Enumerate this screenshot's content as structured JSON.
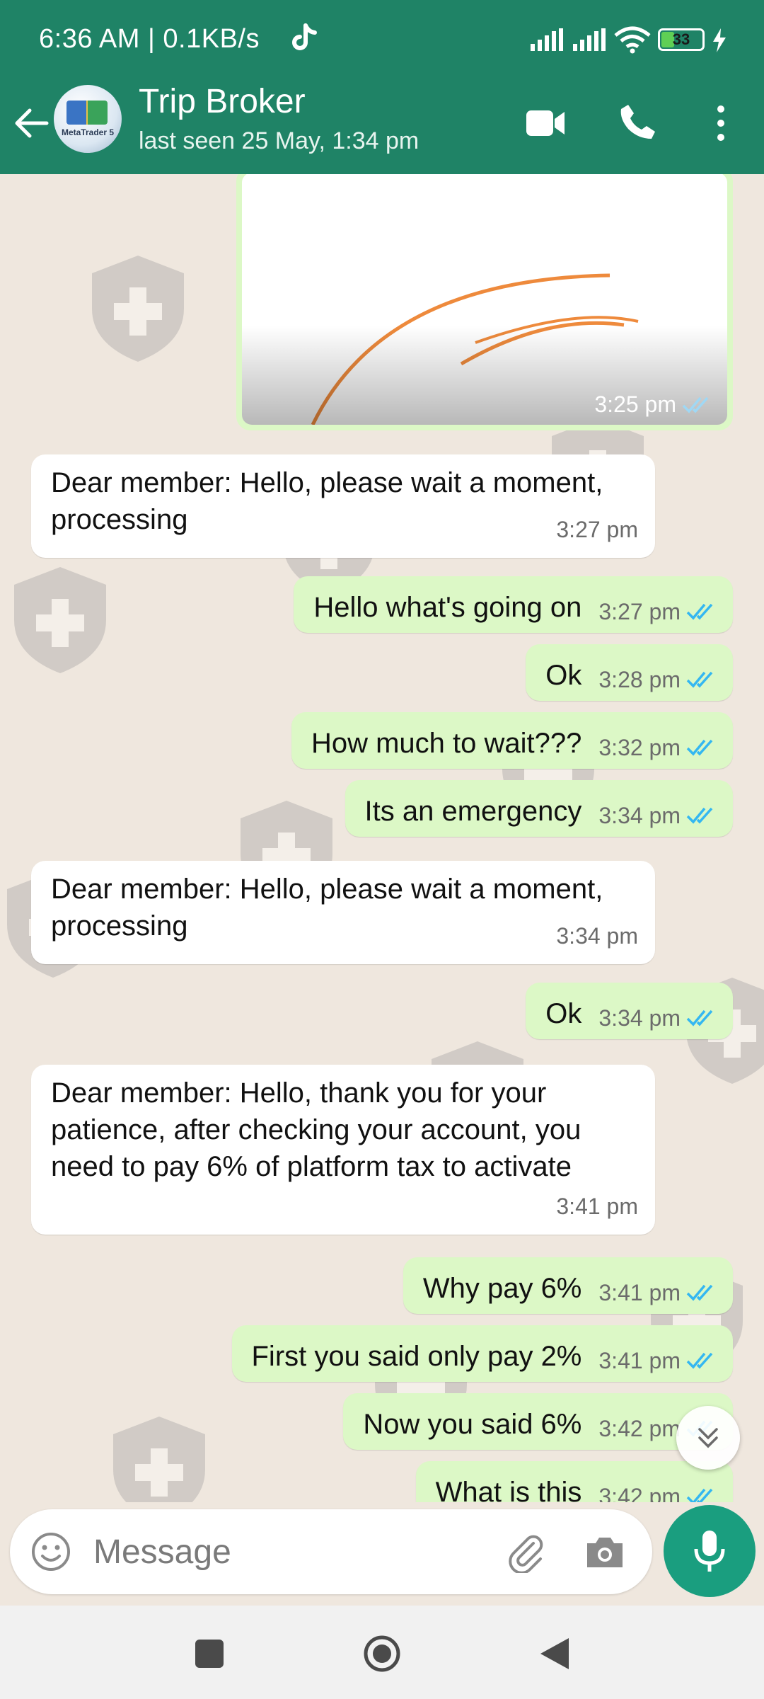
{
  "status_bar": {
    "time": "6:36 AM | 0.1KB/s",
    "battery": "33",
    "battery_level": 0.33
  },
  "header": {
    "contact_name": "Trip Broker",
    "last_seen": "last seen 25 May, 1:34 pm",
    "avatar_text": "MetaTrader 5"
  },
  "image_message": {
    "time": "3:25 pm"
  },
  "messages": [
    {
      "dir": "in",
      "text": "Dear member: Hello, please wait a moment, processing",
      "time": "3:27 pm"
    },
    {
      "dir": "out",
      "text": "Hello what's going on",
      "time": "3:27 pm"
    },
    {
      "dir": "out",
      "text": "Ok",
      "time": "3:28 pm"
    },
    {
      "dir": "out",
      "text": "How much to wait???",
      "time": "3:32 pm"
    },
    {
      "dir": "out",
      "text": "Its an emergency",
      "time": "3:34 pm"
    },
    {
      "dir": "in",
      "text": "Dear member: Hello, please wait a moment, processing",
      "time": "3:34 pm"
    },
    {
      "dir": "out",
      "text": "Ok",
      "time": "3:34 pm"
    },
    {
      "dir": "in",
      "text": "Dear member: Hello, thank you for your patience, after checking your account, you need to pay 6% of platform tax to activate",
      "time": "3:41 pm"
    },
    {
      "dir": "out",
      "text": "Why pay 6%",
      "time": "3:41 pm"
    },
    {
      "dir": "out",
      "text": "First you said only pay 2%",
      "time": "3:41 pm"
    },
    {
      "dir": "out",
      "text": "Now you said 6%",
      "time": "3:42 pm"
    },
    {
      "dir": "out",
      "text": "What is this",
      "time": "3:42 pm"
    }
  ],
  "composer": {
    "placeholder": "Message"
  },
  "colors": {
    "header": "#1f8366",
    "outgoing_bubble": "#dcf8c6",
    "incoming_bubble": "#ffffff",
    "chat_background": "#efe7de",
    "read_tick": "#34b7f1",
    "mic_button": "#1a9e7f"
  },
  "icons": [
    "back-arrow-icon",
    "video-call-icon",
    "phone-icon",
    "more-vert-icon",
    "emoji-icon",
    "attach-icon",
    "camera-icon",
    "mic-icon",
    "chevron-double-down-icon",
    "nav-square-icon",
    "nav-home-icon",
    "nav-back-icon"
  ]
}
